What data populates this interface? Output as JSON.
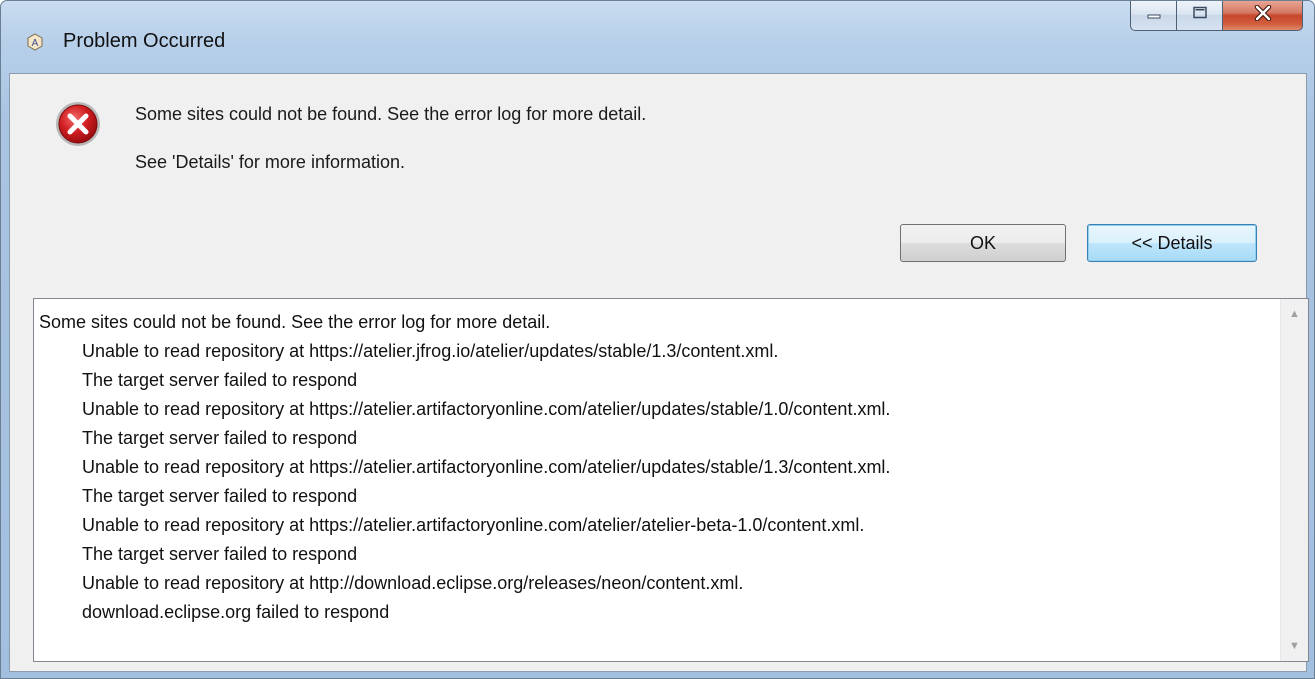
{
  "window": {
    "title": "Problem Occurred",
    "title_icon": "app-icon"
  },
  "caption": {
    "minimize_icon": "minimize-icon",
    "maximize_icon": "maximize-icon",
    "close_icon": "close-icon"
  },
  "dialog": {
    "icon": "error-icon",
    "message": "Some sites could not be found.  See the error log for more detail.",
    "sub_message": "See 'Details' for more information.",
    "ok_label": "OK",
    "details_label": "<< Details"
  },
  "details": {
    "header": "Some sites could not be found.  See the error log for more detail.",
    "lines": [
      "Unable to read repository at https://atelier.jfrog.io/atelier/updates/stable/1.3/content.xml.",
      "The target server failed to respond",
      "Unable to read repository at https://atelier.artifactoryonline.com/atelier/updates/stable/1.0/content.xml.",
      "The target server failed to respond",
      "Unable to read repository at https://atelier.artifactoryonline.com/atelier/updates/stable/1.3/content.xml.",
      "The target server failed to respond",
      "Unable to read repository at https://atelier.artifactoryonline.com/atelier/atelier-beta-1.0/content.xml.",
      "The target server failed to respond",
      "Unable to read repository at http://download.eclipse.org/releases/neon/content.xml.",
      "download.eclipse.org failed to respond"
    ]
  },
  "colors": {
    "error_red": "#c8141b",
    "frame_blue": "#a9c4e2",
    "close_red": "#c7462c"
  }
}
